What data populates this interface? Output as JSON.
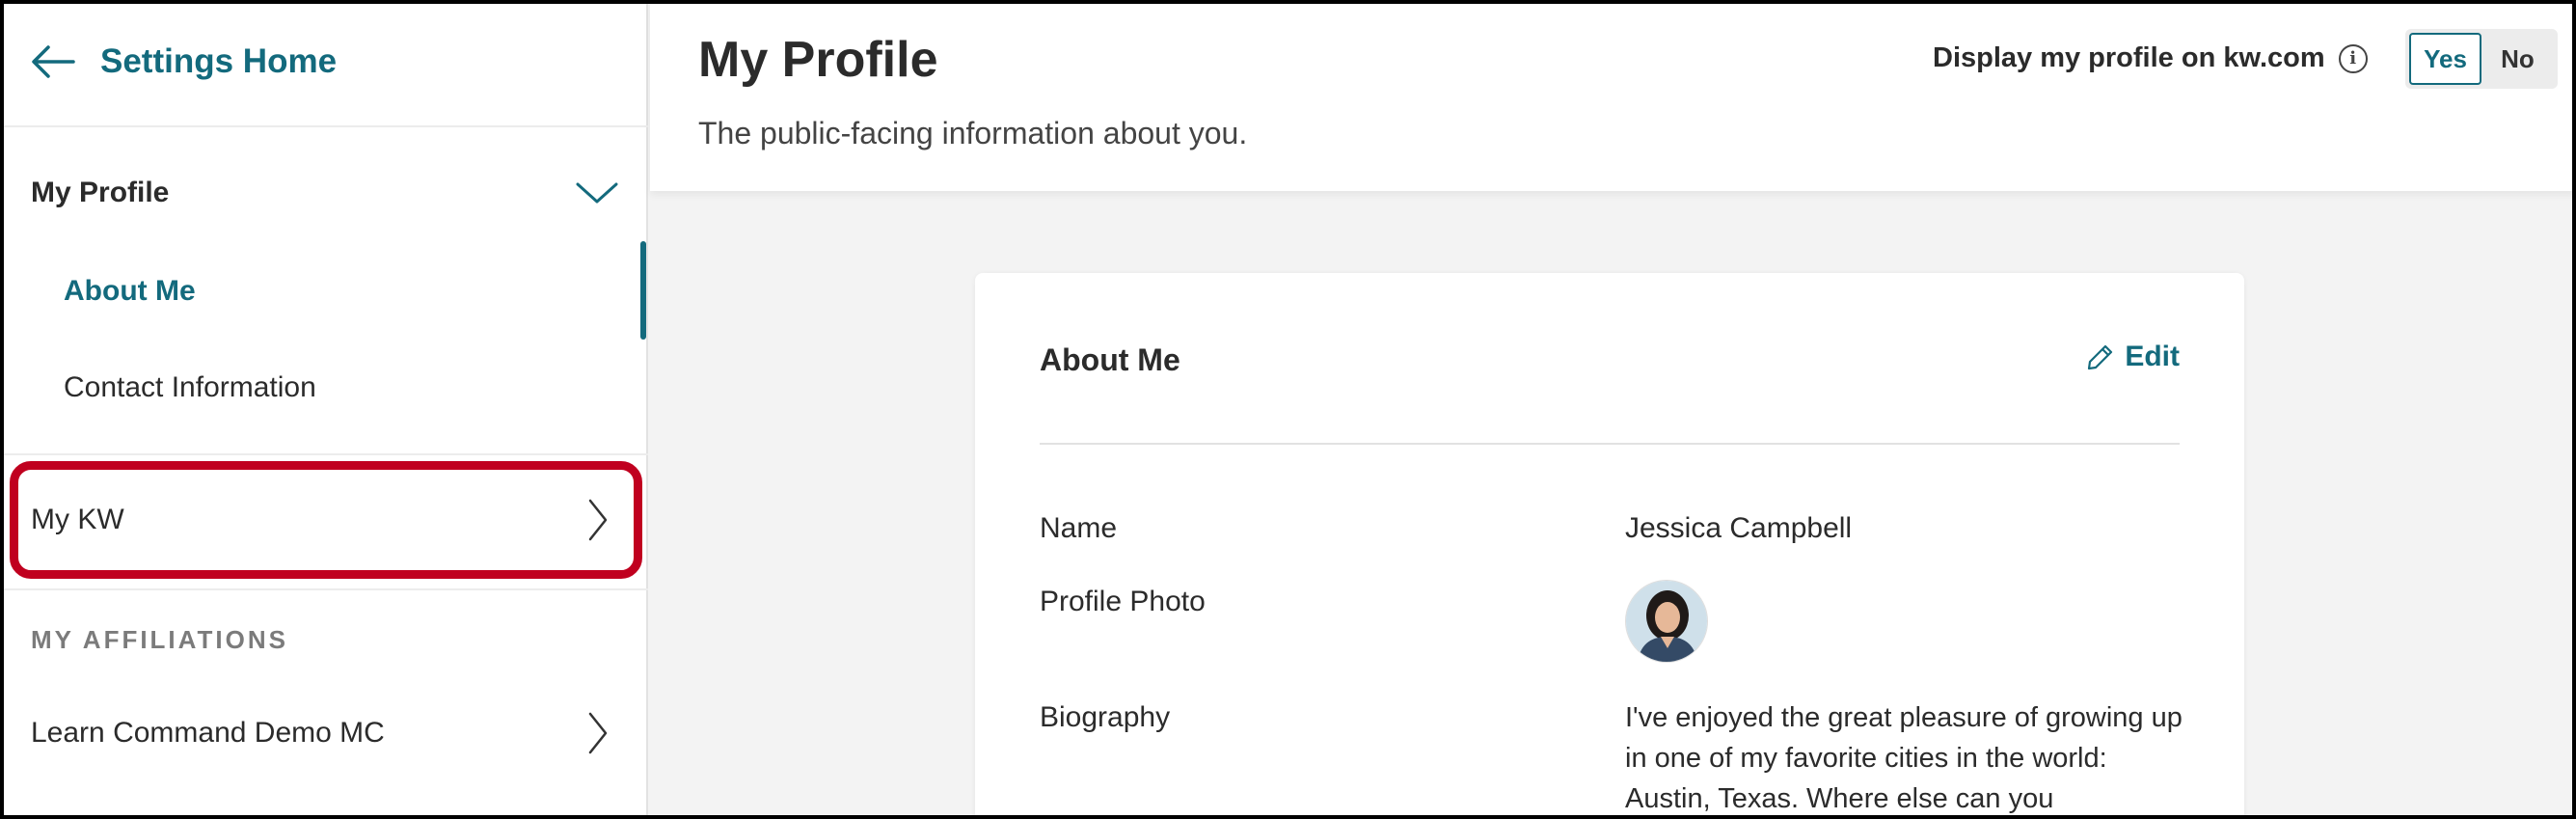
{
  "sidebar": {
    "back_label": "Settings Home",
    "profile_section": {
      "label": "My Profile",
      "items": [
        {
          "label": "About Me",
          "active": true
        },
        {
          "label": "Contact Information",
          "active": false
        }
      ]
    },
    "my_kw": {
      "label": "My KW"
    },
    "affiliations_heading": "MY AFFILIATIONS",
    "affiliations": [
      {
        "label": "Learn Command Demo MC"
      }
    ]
  },
  "header": {
    "title": "My Profile",
    "subtitle": "The public-facing information about you.",
    "display_label": "Display my profile on kw.com",
    "toggle": {
      "yes": "Yes",
      "no": "No",
      "selected": "Yes"
    }
  },
  "card": {
    "title": "About Me",
    "edit_label": "Edit",
    "fields": {
      "name_label": "Name",
      "name_value": "Jessica Campbell",
      "photo_label": "Profile Photo",
      "bio_label": "Biography",
      "bio_value": "I've enjoyed the great pleasure of growing up in one of my favorite cities in the world: Austin, Texas. Where else can you"
    }
  },
  "colors": {
    "accent": "#136a7d",
    "highlight": "#c0001f"
  }
}
